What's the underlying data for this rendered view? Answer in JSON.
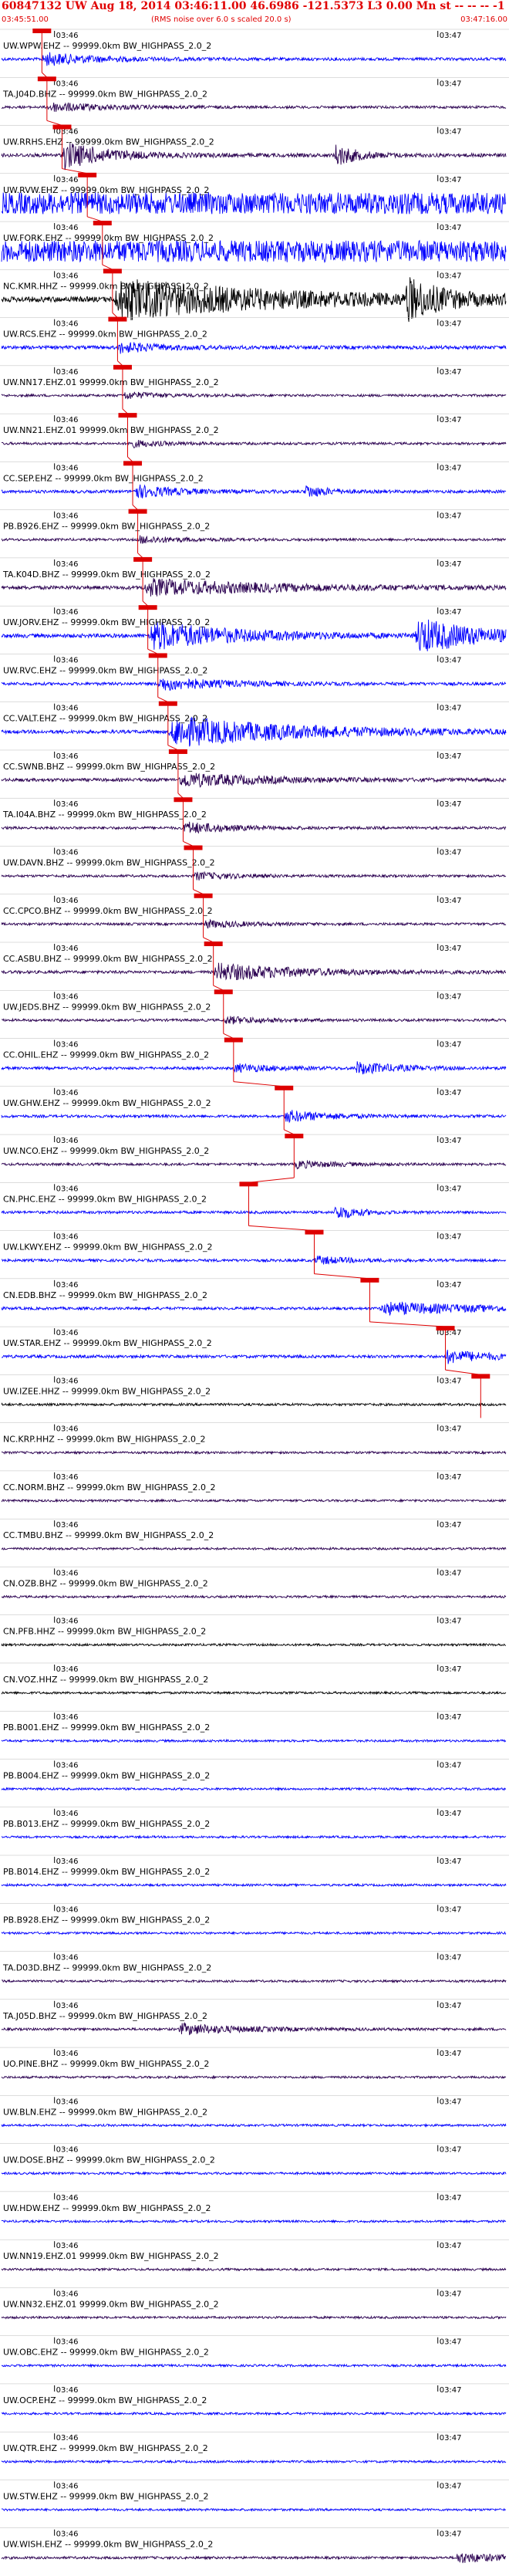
{
  "header": {
    "title": "60847132 UW Aug 18, 2014 03:46:11.00   46.6986 -121.5373  L3 0.00 Mn st -- -- -- -1",
    "start_time": "03:45:51.00",
    "note": "(RMS noise over 6.0 s scaled 20.0 s)",
    "end_time": "03:47:16.00"
  },
  "chart_data": {
    "type": "line",
    "x_range": [
      "03:45:51.00",
      "03:47:16.00"
    ],
    "tick_labels": [
      "03:46",
      "03:47"
    ],
    "series": [
      {
        "label": "UW.WPW.EHZ -- 99999.0km BW_HIGHPASS_2.0_2",
        "color": "#0000ff",
        "amp": 1.2,
        "events": [
          [
            0.08,
            0.12,
            3
          ]
        ],
        "pick": 0.08
      },
      {
        "label": "TA.J04D.BHZ -- 99999.0km BW_HIGHPASS_2.0_2",
        "color": "#2a0050",
        "amp": 1.0,
        "events": [
          [
            0.09,
            0.15,
            2.5
          ]
        ],
        "pick": 0.09
      },
      {
        "label": "UW.RRHS.EHZ -- 99999.0km BW_HIGHPASS_2.0_2",
        "color": "#2a0050",
        "amp": 1.5,
        "events": [
          [
            0.12,
            0.1,
            5
          ],
          [
            0.66,
            0.05,
            4
          ]
        ],
        "pick": 0.12
      },
      {
        "label": "UW.RVW.EHZ -- 99999.0km BW_HIGHPASS_2.0_2",
        "color": "#0000ff",
        "amp": 8,
        "events": [],
        "pick": 0.17,
        "sat": true
      },
      {
        "label": "UW.FORK.EHZ -- 99999.0km BW_HIGHPASS_2.0_2",
        "color": "#0000ff",
        "amp": 8,
        "events": [],
        "pick": 0.2,
        "sat": true
      },
      {
        "label": "NC.KMR.HHZ -- 99999.0km BW_HIGHPASS_2.0_2",
        "color": "#000000",
        "amp": 2.2,
        "events": [
          [
            0.22,
            0.4,
            5
          ],
          [
            0.8,
            0.08,
            5
          ]
        ],
        "pick": 0.22
      },
      {
        "label": "UW.RCS.EHZ -- 99999.0km BW_HIGHPASS_2.0_2",
        "color": "#0000ff",
        "amp": 1.4,
        "events": [
          [
            0.23,
            0.1,
            2
          ]
        ],
        "pick": 0.23
      },
      {
        "label": "UW.NN17.EHZ.01 99999.0km BW_HIGHPASS_2.0_2",
        "color": "#2a0050",
        "amp": 1.0,
        "events": [
          [
            0.24,
            0.08,
            2
          ]
        ],
        "pick": 0.24
      },
      {
        "label": "UW.NN21.EHZ.01 99999.0km BW_HIGHPASS_2.0_2",
        "color": "#2a0050",
        "amp": 1.0,
        "events": [
          [
            0.25,
            0.08,
            2
          ]
        ],
        "pick": 0.25
      },
      {
        "label": "CC.SEP.EHZ -- 99999.0km BW_HIGHPASS_2.0_2",
        "color": "#0000ff",
        "amp": 1.2,
        "events": [
          [
            0.26,
            0.1,
            3
          ],
          [
            0.6,
            0.05,
            3
          ]
        ],
        "pick": 0.26
      },
      {
        "label": "PB.B926.EHZ -- 99999.0km BW_HIGHPASS_2.0_2",
        "color": "#2a0050",
        "amp": 1.0,
        "events": [
          [
            0.27,
            0.1,
            2
          ]
        ],
        "pick": 0.27
      },
      {
        "label": "TA.K04D.BHZ -- 99999.0km BW_HIGHPASS_2.0_2",
        "color": "#2a0050",
        "amp": 1.5,
        "events": [
          [
            0.28,
            0.3,
            3
          ]
        ],
        "pick": 0.28
      },
      {
        "label": "UW.JORV.EHZ -- 99999.0km BW_HIGHPASS_2.0_2",
        "color": "#0000ff",
        "amp": 1.6,
        "events": [
          [
            0.29,
            0.2,
            5
          ],
          [
            0.82,
            0.15,
            6
          ]
        ],
        "pick": 0.29
      },
      {
        "label": "UW.RVC.EHZ -- 99999.0km BW_HIGHPASS_2.0_2",
        "color": "#0000ff",
        "amp": 1.2,
        "events": [
          [
            0.31,
            0.15,
            3
          ]
        ],
        "pick": 0.31
      },
      {
        "label": "CC.VALT.EHZ -- 99999.0km BW_HIGHPASS_2.0_2",
        "color": "#0000ff",
        "amp": 1.4,
        "events": [
          [
            0.33,
            0.3,
            6
          ]
        ],
        "pick": 0.33
      },
      {
        "label": "CC.SWNB.BHZ -- 99999.0km BW_HIGHPASS_2.0_2",
        "color": "#2a0050",
        "amp": 1.3,
        "events": [
          [
            0.35,
            0.2,
            3
          ]
        ],
        "pick": 0.35
      },
      {
        "label": "TA.I04A.BHZ -- 99999.0km BW_HIGHPASS_2.0_2",
        "color": "#2a0050",
        "amp": 1.1,
        "events": [
          [
            0.36,
            0.1,
            3
          ]
        ],
        "pick": 0.36
      },
      {
        "label": "UW.DAVN.BHZ -- 99999.0km BW_HIGHPASS_2.0_2",
        "color": "#2a0050",
        "amp": 1.0,
        "events": [
          [
            0.38,
            0.1,
            2
          ]
        ],
        "pick": 0.38
      },
      {
        "label": "CC.CPCO.BHZ -- 99999.0km BW_HIGHPASS_2.0_2",
        "color": "#2a0050",
        "amp": 1.0,
        "events": [
          [
            0.4,
            0.1,
            2
          ]
        ],
        "pick": 0.4
      },
      {
        "label": "CC.ASBU.BHZ -- 99999.0km BW_HIGHPASS_2.0_2",
        "color": "#2a0050",
        "amp": 1.2,
        "events": [
          [
            0.42,
            0.2,
            4
          ]
        ],
        "pick": 0.42
      },
      {
        "label": "UW.JEDS.BHZ -- 99999.0km BW_HIGHPASS_2.0_2",
        "color": "#2a0050",
        "amp": 1.0,
        "events": [
          [
            0.44,
            0.1,
            2
          ]
        ],
        "pick": 0.44
      },
      {
        "label": "CC.OHIL.EHZ -- 99999.0km BW_HIGHPASS_2.0_2",
        "color": "#0000ff",
        "amp": 1.1,
        "events": [
          [
            0.46,
            0.1,
            2
          ],
          [
            0.7,
            0.1,
            3
          ]
        ],
        "pick": 0.46
      },
      {
        "label": "UW.GHW.EHZ -- 99999.0km BW_HIGHPASS_2.0_2",
        "color": "#0000ff",
        "amp": 1.1,
        "events": [
          [
            0.56,
            0.1,
            3
          ]
        ],
        "pick": 0.56
      },
      {
        "label": "UW.NCO.EHZ -- 99999.0km BW_HIGHPASS_2.0_2",
        "color": "#2a0050",
        "amp": 1.0,
        "events": [
          [
            0.58,
            0.1,
            2
          ]
        ],
        "pick": 0.58
      },
      {
        "label": "CN.PHC.EHZ -- 99999.0km BW_HIGHPASS_2.0_2",
        "color": "#0000ff",
        "amp": 1.1,
        "events": [
          [
            0.66,
            0.05,
            4
          ]
        ],
        "pick": 0.49
      },
      {
        "label": "UW.LKWY.EHZ -- 99999.0km BW_HIGHPASS_2.0_2",
        "color": "#0000ff",
        "amp": 1.1,
        "events": [
          [
            0.62,
            0.08,
            2
          ]
        ],
        "pick": 0.62
      },
      {
        "label": "CN.EDB.BHZ -- 99999.0km BW_HIGHPASS_2.0_2",
        "color": "#0000ff",
        "amp": 1.1,
        "events": [
          [
            0.75,
            0.25,
            3
          ]
        ],
        "pick": 0.73
      },
      {
        "label": "UW.STAR.EHZ -- 99999.0km BW_HIGHPASS_2.0_2",
        "color": "#0000ff",
        "amp": 1.2,
        "events": [
          [
            0.88,
            0.1,
            3
          ]
        ],
        "pick": 0.88
      },
      {
        "label": "UW.IZEE.HHZ -- 99999.0km BW_HIGHPASS_2.0_2",
        "color": "#000000",
        "amp": 1.0,
        "events": [],
        "pick": 0.95
      },
      {
        "label": "NC.KRP.HHZ -- 99999.0km BW_HIGHPASS_2.0_2",
        "color": "#2a0050",
        "amp": 0.9,
        "events": [],
        "pick": null
      },
      {
        "label": "CC.NORM.BHZ -- 99999.0km BW_HIGHPASS_2.0_2",
        "color": "#2a0050",
        "amp": 0.9,
        "events": [],
        "pick": null
      },
      {
        "label": "CC.TMBU.BHZ -- 99999.0km BW_HIGHPASS_2.0_2",
        "color": "#2a0050",
        "amp": 0.9,
        "events": [],
        "pick": null
      },
      {
        "label": "CN.OZB.BHZ -- 99999.0km BW_HIGHPASS_2.0_2",
        "color": "#2a0050",
        "amp": 0.9,
        "events": [],
        "pick": null
      },
      {
        "label": "CN.PFB.HHZ -- 99999.0km BW_HIGHPASS_2.0_2",
        "color": "#000000",
        "amp": 0.9,
        "events": [],
        "pick": null
      },
      {
        "label": "CN.VOZ.HHZ -- 99999.0km BW_HIGHPASS_2.0_2",
        "color": "#000000",
        "amp": 0.9,
        "events": [],
        "pick": null
      },
      {
        "label": "PB.B001.EHZ -- 99999.0km BW_HIGHPASS_2.0_2",
        "color": "#0000ff",
        "amp": 0.9,
        "events": [],
        "pick": null
      },
      {
        "label": "PB.B004.EHZ -- 99999.0km BW_HIGHPASS_2.0_2",
        "color": "#0000ff",
        "amp": 0.9,
        "events": [],
        "pick": null
      },
      {
        "label": "PB.B013.EHZ -- 99999.0km BW_HIGHPASS_2.0_2",
        "color": "#0000ff",
        "amp": 0.9,
        "events": [],
        "pick": null
      },
      {
        "label": "PB.B014.EHZ -- 99999.0km BW_HIGHPASS_2.0_2",
        "color": "#0000ff",
        "amp": 0.9,
        "events": [],
        "pick": null
      },
      {
        "label": "PB.B928.EHZ -- 99999.0km BW_HIGHPASS_2.0_2",
        "color": "#0000ff",
        "amp": 0.9,
        "events": [],
        "pick": null
      },
      {
        "label": "TA.D03D.BHZ -- 99999.0km BW_HIGHPASS_2.0_2",
        "color": "#2a0050",
        "amp": 0.9,
        "events": [],
        "pick": null
      },
      {
        "label": "TA.J05D.BHZ -- 99999.0km BW_HIGHPASS_2.0_2",
        "color": "#2a0050",
        "amp": 1.0,
        "events": [
          [
            0.35,
            0.15,
            3
          ]
        ],
        "pick": null
      },
      {
        "label": "UO.PINE.BHZ -- 99999.0km BW_HIGHPASS_2.0_2",
        "color": "#2a0050",
        "amp": 0.9,
        "events": [],
        "pick": null
      },
      {
        "label": "UW.BLN.EHZ -- 99999.0km BW_HIGHPASS_2.0_2",
        "color": "#0000ff",
        "amp": 0.9,
        "events": [],
        "pick": null
      },
      {
        "label": "UW.DOSE.BHZ -- 99999.0km BW_HIGHPASS_2.0_2",
        "color": "#0000ff",
        "amp": 0.9,
        "events": [],
        "pick": null
      },
      {
        "label": "UW.HDW.EHZ -- 99999.0km BW_HIGHPASS_2.0_2",
        "color": "#0000ff",
        "amp": 0.9,
        "events": [],
        "pick": null
      },
      {
        "label": "UW.NN19.EHZ.01 99999.0km BW_HIGHPASS_2.0_2",
        "color": "#2a0050",
        "amp": 0.9,
        "events": [],
        "pick": null
      },
      {
        "label": "UW.NN32.EHZ.01 99999.0km BW_HIGHPASS_2.0_2",
        "color": "#2a0050",
        "amp": 0.9,
        "events": [],
        "pick": null
      },
      {
        "label": "UW.OBC.EHZ -- 99999.0km BW_HIGHPASS_2.0_2",
        "color": "#0000ff",
        "amp": 0.9,
        "events": [],
        "pick": null
      },
      {
        "label": "UW.OCP.EHZ -- 99999.0km BW_HIGHPASS_2.0_2",
        "color": "#0000ff",
        "amp": 0.9,
        "events": [],
        "pick": null
      },
      {
        "label": "UW.QTR.EHZ -- 99999.0km BW_HIGHPASS_2.0_2",
        "color": "#0000ff",
        "amp": 0.9,
        "events": [],
        "pick": null
      },
      {
        "label": "UW.STW.EHZ -- 99999.0km BW_HIGHPASS_2.0_2",
        "color": "#0000ff",
        "amp": 0.9,
        "events": [],
        "pick": null
      },
      {
        "label": "UW.WISH.EHZ -- 99999.0km BW_HIGHPASS_2.0_2",
        "color": "#2a0050",
        "amp": 1.0,
        "events": [
          [
            0.9,
            0.1,
            3
          ]
        ],
        "pick": null
      }
    ]
  }
}
